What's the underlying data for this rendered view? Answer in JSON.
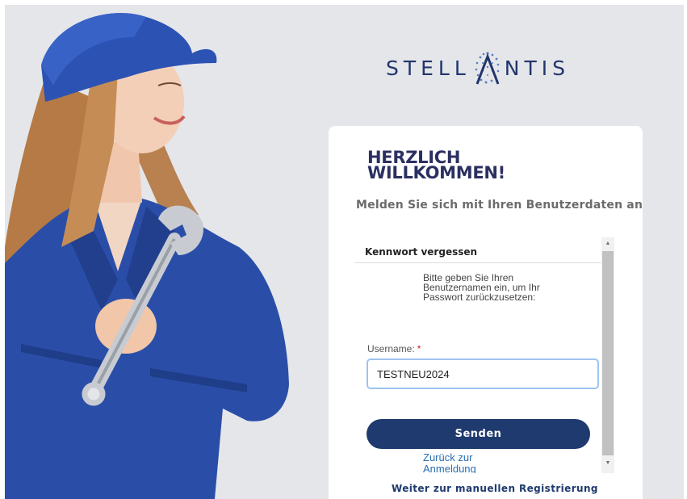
{
  "brand": {
    "logo_left": "STELL",
    "logo_right": "NTIS",
    "color": "#23356b"
  },
  "card": {
    "title": "HERZLICH WILLKOMMEN!",
    "subtitle": "Melden Sie sich mit Ihren Benutzerdaten an",
    "frame_heading": "Kennwort vergessen",
    "instructions": "Bitte geben Sie Ihren Benutzernamen ein, um Ihr Passwort zurückzusetzen:",
    "username_label": "Username:",
    "required_marker": "*",
    "username_value": "TESTNEU2024",
    "send_label": "Senden",
    "back_link": "Zurück zur Anmeldung",
    "register_link": "Weiter zur manuellen Registrierung"
  },
  "colors": {
    "primary": "#1f3a6e",
    "link": "#2a6db0",
    "background": "#e4e6ea",
    "input_border": "#9ec3ef"
  },
  "icons": {
    "scroll_up": "triangle-up",
    "scroll_down": "triangle-down"
  }
}
